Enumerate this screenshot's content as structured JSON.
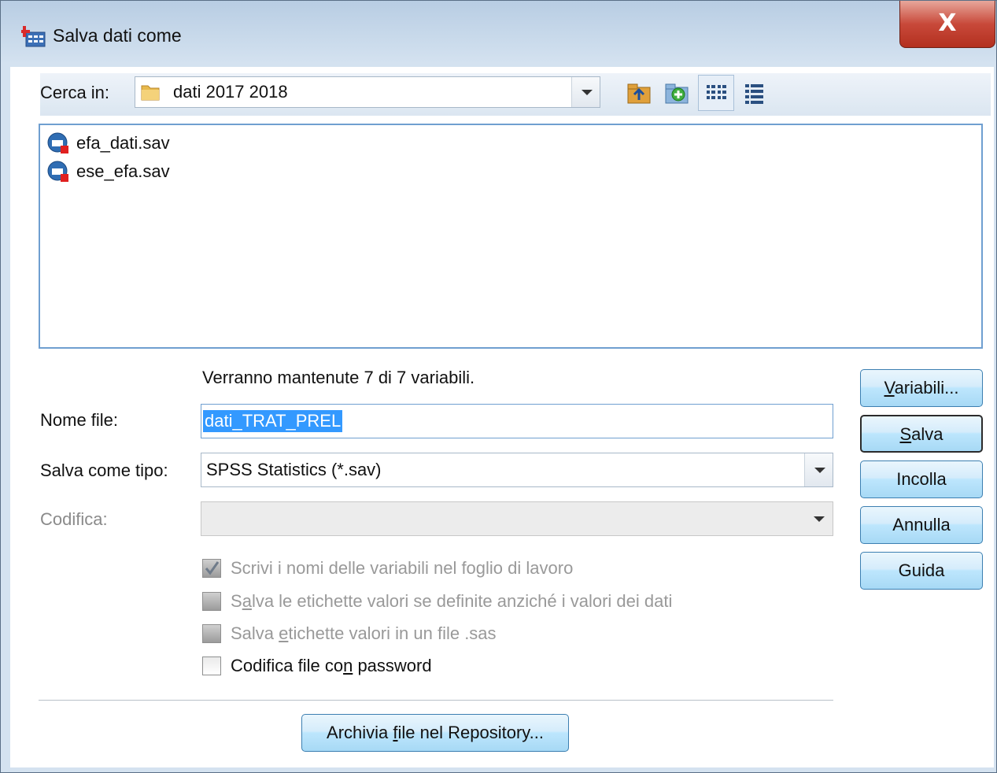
{
  "window": {
    "title": "Salva dati come",
    "close_label": "X"
  },
  "look_in": {
    "label": "Cerca in:",
    "value": "dati 2017 2018"
  },
  "toolbar": {
    "icons": [
      "folder-up-icon",
      "new-folder-icon",
      "list-view-icon",
      "details-view-icon"
    ]
  },
  "files": [
    {
      "name": "efa_dati.sav"
    },
    {
      "name": "ese_efa.sav"
    }
  ],
  "info_text": "Verranno mantenute 7 di 7 variabili.",
  "file_name": {
    "label": "Nome file:",
    "value": "dati_TRAT_PREL"
  },
  "save_type": {
    "label": "Salva come tipo:",
    "value": "SPSS Statistics (*.sav)"
  },
  "encoding": {
    "label": "Codifica:",
    "value": ""
  },
  "options": [
    {
      "pre": "Scrivi i nomi delle variabili nel foglio di lavoro",
      "u": "",
      "post": "",
      "checked": true,
      "enabled": false
    },
    {
      "pre": "S",
      "u": "a",
      "post": "lva le etichette valori se definite anziché i valori dei dati",
      "checked": false,
      "enabled": false
    },
    {
      "pre": "Salva ",
      "u": "e",
      "post": "tichette valori in un file .sas",
      "checked": false,
      "enabled": false
    },
    {
      "pre": "Codifica file co",
      "u": "n",
      "post": " password",
      "checked": false,
      "enabled": true
    }
  ],
  "buttons": {
    "variables": {
      "u": "V",
      "rest": "ariabili..."
    },
    "save": {
      "u": "S",
      "rest": "alva"
    },
    "paste": "Incolla",
    "cancel": "Annulla",
    "help": "Guida",
    "repository": {
      "pre": "Archivia ",
      "u": "f",
      "post": "ile nel Repository..."
    }
  },
  "colors": {
    "selection": "#3399ff",
    "focus_border": "#6f9fd0",
    "close_red": "#c8493a"
  }
}
